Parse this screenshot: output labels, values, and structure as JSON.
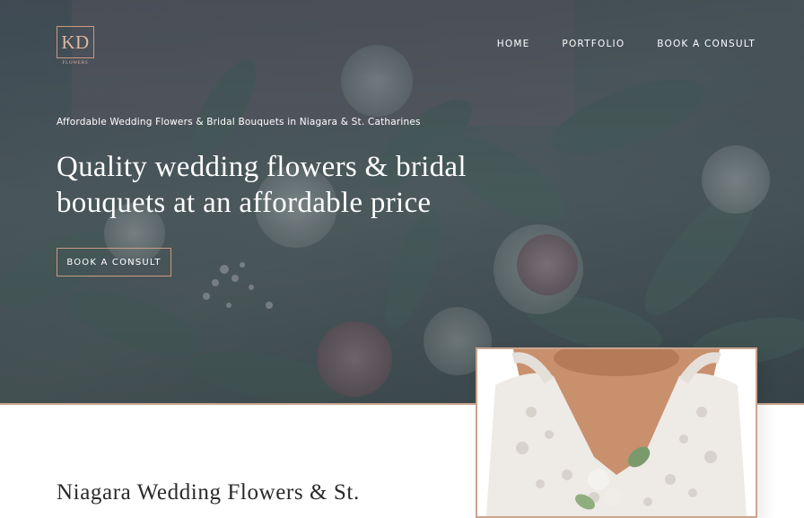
{
  "brand": {
    "logo_text": "KD",
    "logo_subtext": "FLOWERS",
    "accent_color": "#c89b84"
  },
  "nav": {
    "items": [
      {
        "label": "HOME"
      },
      {
        "label": "PORTFOLIO"
      },
      {
        "label": "BOOK A CONSULT"
      }
    ]
  },
  "hero": {
    "eyebrow": "Affordable Wedding Flowers & Bridal Bouquets in Niagara & St. Catharines",
    "headline": "Quality wedding flowers & bridal bouquets at an affordable price",
    "cta_label": "BOOK A CONSULT",
    "background_image": "floral-bouquet-photo"
  },
  "intro": {
    "title": "Niagara Wedding Flowers & St.",
    "image": "bride-in-lace-dress-photo"
  }
}
